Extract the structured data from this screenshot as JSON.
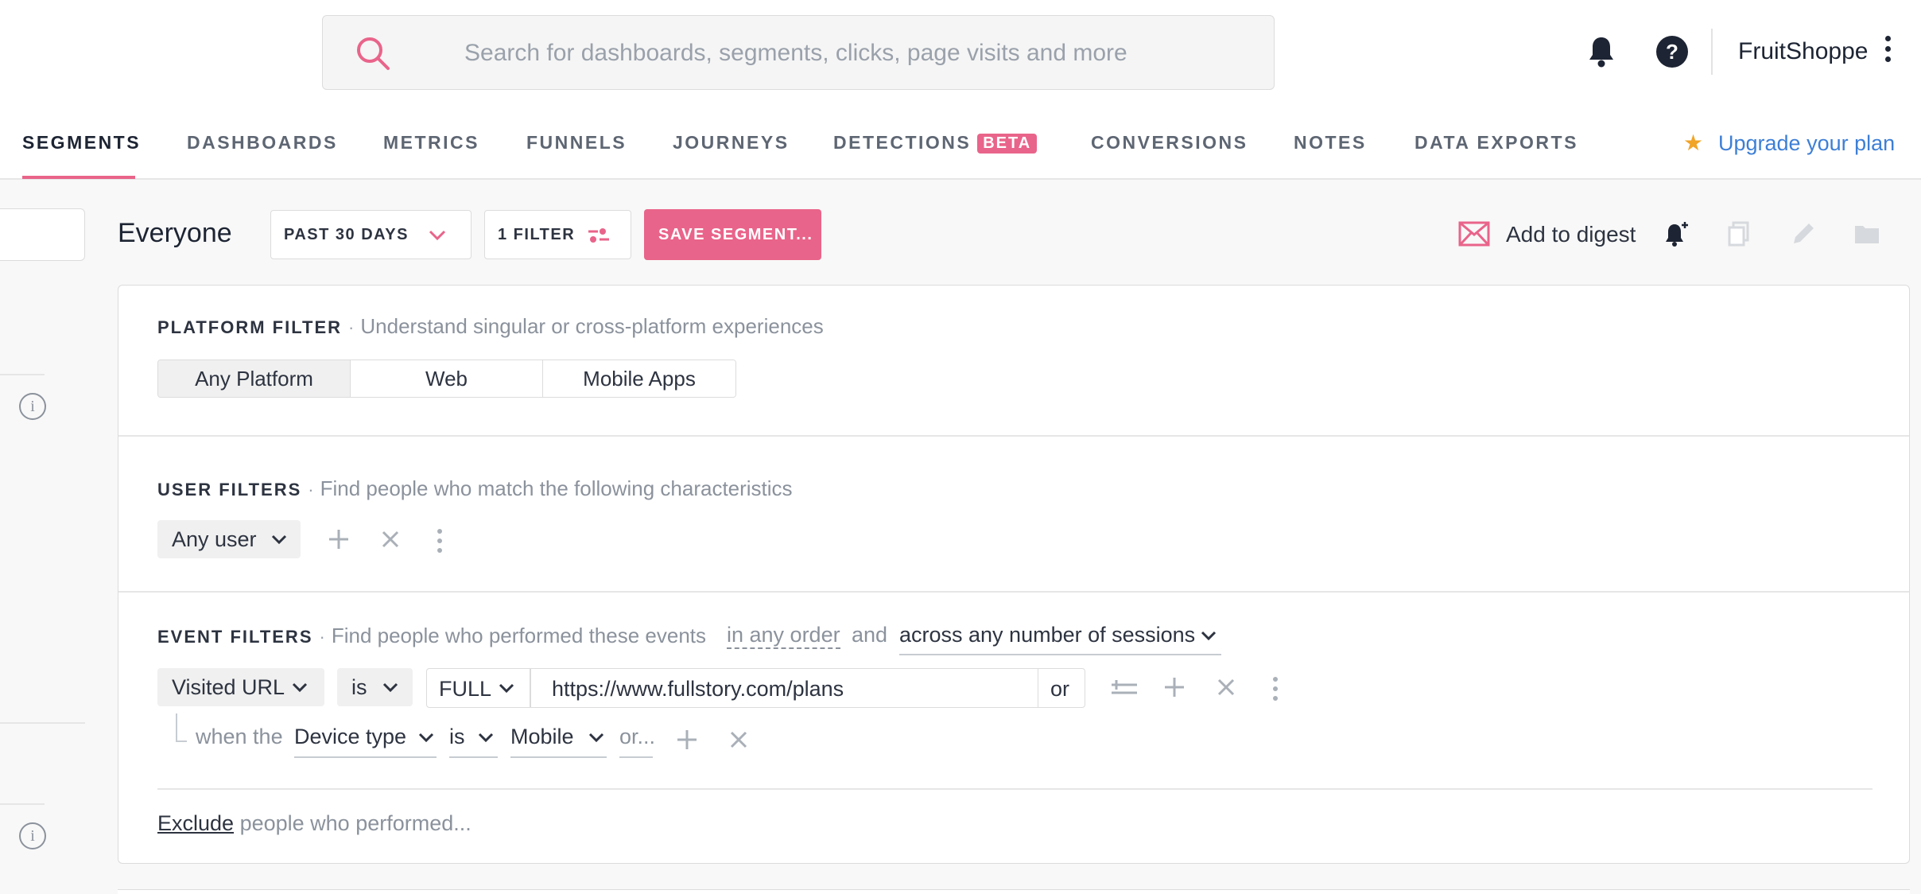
{
  "header": {
    "search_placeholder": "Search for dashboards, segments, clicks, page visits and more",
    "account_name": "FruitShoppe",
    "help_glyph": "?",
    "icons": [
      "search-icon",
      "bell-icon",
      "help-icon",
      "more-vertical-icon"
    ]
  },
  "nav": {
    "tabs": [
      {
        "label": "SEGMENTS",
        "active": true
      },
      {
        "label": "DASHBOARDS"
      },
      {
        "label": "METRICS"
      },
      {
        "label": "FUNNELS"
      },
      {
        "label": "JOURNEYS"
      },
      {
        "label": "DETECTIONS",
        "badge": "BETA"
      },
      {
        "label": "CONVERSIONS"
      },
      {
        "label": "NOTES"
      },
      {
        "label": "DATA EXPORTS"
      }
    ],
    "upgrade_label": "Upgrade your plan",
    "upgrade_star": "★"
  },
  "toolbar": {
    "segment_name": "Everyone",
    "date_range": "PAST 30 DAYS",
    "filter_count": "1 FILTER",
    "save_label": "SAVE SEGMENT...",
    "digest_label": "Add to digest"
  },
  "platform": {
    "title": "PLATFORM FILTER",
    "separator": "·",
    "description": "Understand singular or cross-platform experiences",
    "options": [
      "Any Platform",
      "Web",
      "Mobile Apps"
    ],
    "selected": "Any Platform"
  },
  "user_filters": {
    "title": "USER FILTERS",
    "separator": "·",
    "description": "Find people who match the following characteristics",
    "selector": "Any user"
  },
  "event_filters": {
    "title": "EVENT FILTERS",
    "separator": "·",
    "description": "Find people who performed these events",
    "order": "in any order",
    "and": "and",
    "sessions": "across any number of sessions",
    "event": "Visited URL",
    "operator": "is",
    "match_type": "FULL",
    "url_value": "https://www.fullstory.com/plans",
    "or_label": "or",
    "sub": {
      "prefix": "when the",
      "property": "Device type",
      "operator": "is",
      "value": "Mobile",
      "or_more": "or..."
    },
    "exclude_link": "Exclude",
    "exclude_rest": "people who performed..."
  },
  "colors": {
    "accent_pink": "#e9648a",
    "link_blue": "#3d7fd6",
    "star": "#f0a428",
    "text_dark": "#1d2433",
    "muted": "#8b929c"
  }
}
